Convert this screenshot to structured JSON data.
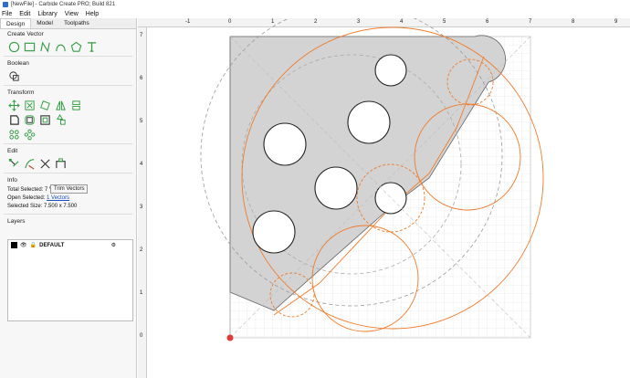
{
  "window": {
    "title": "[NewFile] - Carbide Create PRO; Build 821"
  },
  "menu": [
    "File",
    "Edit",
    "Library",
    "View",
    "Help"
  ],
  "tabs": [
    "Design",
    "Model",
    "Toolpaths"
  ],
  "sections": {
    "create_vector": "Create Vector",
    "boolean": "Boolean",
    "transform": "Transform",
    "edit": "Edit",
    "info": "Info",
    "layers": "Layers"
  },
  "tooltip": "Trim Vectors",
  "info": {
    "total_selected_label": "Total Selected:",
    "total_selected_value": "7 Vectors",
    "open_selected_label": "Open Selected:",
    "open_selected_value": "1 Vectors",
    "selected_size_label": "Selected Size:",
    "selected_size_value": "7.500 x 7.500"
  },
  "layer": {
    "name": "DEFAULT",
    "color": "#000000"
  },
  "ruler": {
    "top": [
      "-1",
      "0",
      "1",
      "2",
      "3",
      "4",
      "5",
      "6",
      "7",
      "8",
      "9"
    ],
    "left": [
      "7",
      "6",
      "5",
      "4",
      "3",
      "2",
      "1",
      "0"
    ]
  },
  "colors": {
    "accent": "#f07b2a",
    "tool_green": "#2e9e3e",
    "grid": "#d9d9d9",
    "fill_gray": "#d3d3d3"
  }
}
